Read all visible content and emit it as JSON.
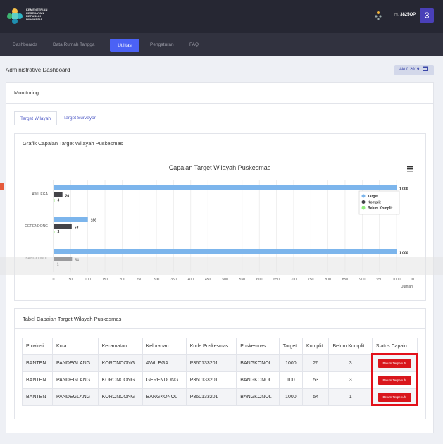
{
  "header": {
    "logo_text": [
      "KEMENTERIAN",
      "KESEHATAN",
      "REPUBLIK",
      "INDONESIA"
    ],
    "user_prefix": "Hi,",
    "user_name": "3825OP",
    "notification_count": "3"
  },
  "nav": {
    "items": [
      "Dashboards",
      "Data Rumah Tangga",
      "Utilitas",
      "Pengaturan",
      "FAQ"
    ],
    "active": "Utilitas"
  },
  "page": {
    "title": "Administrative Dashboard",
    "aktif_label": "Aktif:",
    "aktif_year": "2019"
  },
  "monitoring": {
    "title": "Monitoring",
    "tabs": [
      "Target Wilayah",
      "Target Surveyor"
    ]
  },
  "chart_card": {
    "title": "Grafik Capaian Target Wilayah Puskesmas"
  },
  "chart_data": {
    "type": "bar",
    "title": "Capaian Target Wilayah Puskesmas",
    "orientation": "horizontal",
    "categories": [
      "AWILEGA",
      "GERENDONG",
      "BANGKONOL"
    ],
    "series": [
      {
        "name": "Target",
        "values": [
          1000,
          100,
          1000
        ],
        "color": "#7cb5ec"
      },
      {
        "name": "Komplit",
        "values": [
          26,
          53,
          54
        ],
        "color": "#434348"
      },
      {
        "name": "Belum Komplit",
        "values": [
          3,
          3,
          1
        ],
        "color": "#90ed7d"
      }
    ],
    "xlabel": "Jumlah",
    "xlim": [
      0,
      1000
    ],
    "x_ticks": [
      "0",
      "50",
      "100",
      "150",
      "200",
      "250",
      "300",
      "350",
      "400",
      "450",
      "500",
      "550",
      "600",
      "650",
      "700",
      "750",
      "800",
      "850",
      "900",
      "950",
      "1000",
      "10..."
    ],
    "data_labels": [
      "1 000",
      "26",
      "3",
      "100",
      "53",
      "3",
      "1 000",
      "54",
      "1"
    ],
    "legend": "top-right",
    "grid": true
  },
  "table_card": {
    "title": "Tabel Capaian Target Wilayah Puskesmas",
    "headers": [
      "Provinsi",
      "Kota",
      "Kecamatan",
      "Kelurahan",
      "Kode Puskesmas",
      "Puskesmas",
      "Target",
      "Komplit",
      "Belum Komplit",
      "Status Capain"
    ],
    "rows": [
      [
        "BANTEN",
        "PANDEGLANG",
        "KORONCONG",
        "AWILEGA",
        "P360133201",
        "BANGKONOL",
        "1000",
        "26",
        "3",
        "Belum Terpenuhi"
      ],
      [
        "BANTEN",
        "PANDEGLANG",
        "KORONCONG",
        "GERENDONG",
        "P360133201",
        "BANGKONOL",
        "100",
        "53",
        "3",
        "Belum Terpenuhi"
      ],
      [
        "BANTEN",
        "PANDEGLANG",
        "KORONCONG",
        "BANGKONOL",
        "P360133201",
        "BANGKONOL",
        "1000",
        "54",
        "1",
        "Belum Terpenuhi"
      ]
    ]
  },
  "colors": {
    "topbar": "#262733",
    "navbar": "#31323f",
    "accent": "#4b62f5",
    "badge": "#4a40b8",
    "status_red": "#d9161c"
  }
}
